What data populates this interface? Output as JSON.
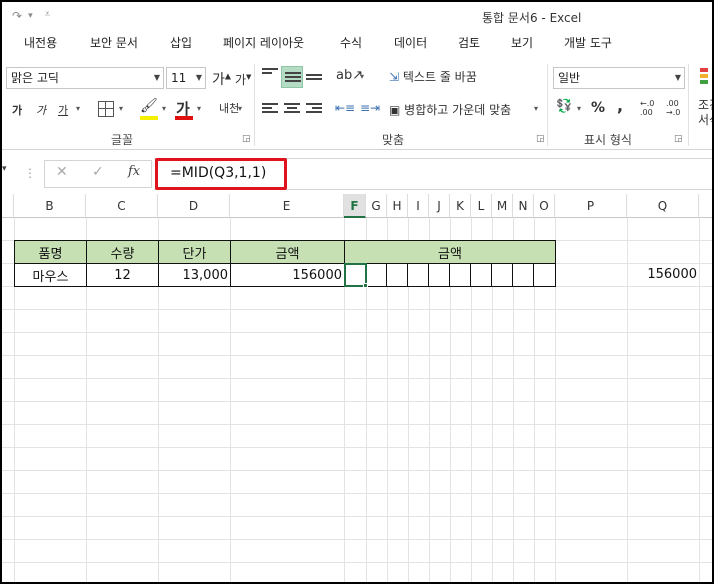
{
  "window": {
    "title": "통합 문서6 - Excel"
  },
  "qat": {
    "redo_icon": "redo-icon",
    "customize_icon": "customize-qat-icon"
  },
  "tabs": [
    "내전용",
    "보안 문서",
    "삽입",
    "페이지 레이아웃",
    "수식",
    "데이터",
    "검토",
    "보기",
    "개발 도구"
  ],
  "ribbon": {
    "font_name": "맑은 고딕",
    "font_size": "11",
    "grow_font": "가",
    "shrink_font": "가",
    "bold": "가",
    "italic": "가",
    "underline": "가",
    "font_color_glyph": "가",
    "phonetic": "내천",
    "group_font": "글꼴",
    "wrap_text": "텍스트 줄 바꿈",
    "merge_center": "병합하고 가운데 맞춤",
    "group_align": "맞춤",
    "number_format": "일반",
    "percent": "%",
    "comma": ",",
    "group_number": "표시 형식",
    "cond_format_partial": "조건",
    "cell_style_partial": "서식",
    "increase_decimal_top": "←.0",
    "increase_decimal_bottom": ".00",
    "decrease_decimal_top": ".00",
    "decrease_decimal_bottom": "→.0"
  },
  "formula_bar": {
    "formula": "=MID(Q3,1,1)"
  },
  "grid": {
    "columns": [
      "B",
      "C",
      "D",
      "E",
      "F",
      "G",
      "H",
      "I",
      "J",
      "K",
      "L",
      "M",
      "N",
      "O",
      "P",
      "Q"
    ],
    "selected_column": "F",
    "table_headers": [
      "품명",
      "수량",
      "단가",
      "금액",
      "금액"
    ],
    "row": {
      "name": "마우스",
      "qty": "12",
      "price": "13,000",
      "amount": "156000"
    },
    "q3_value": "156000"
  },
  "colors": {
    "header_fill": "#c6e0b4",
    "excel_green": "#217346",
    "highlight_red": "#e0121d"
  }
}
